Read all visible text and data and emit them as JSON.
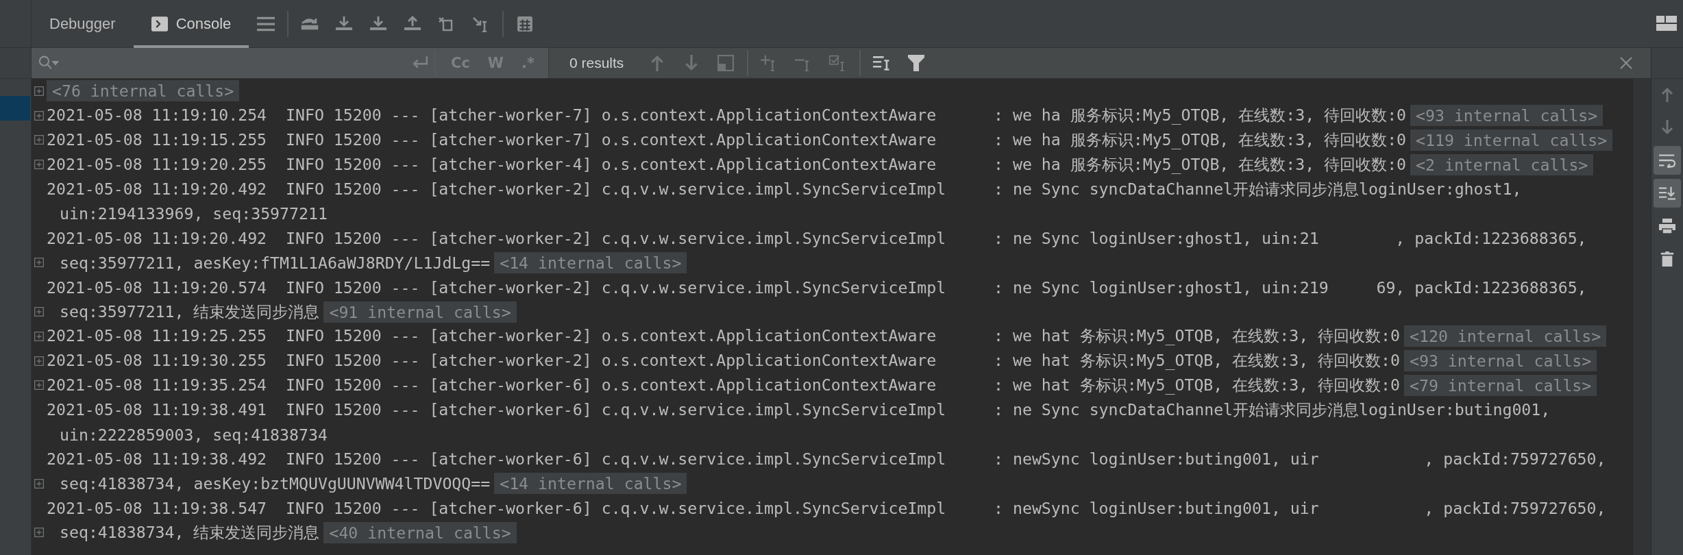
{
  "tabs": [
    {
      "label": "Debugger",
      "kind": "plain",
      "selected": false
    },
    {
      "label": "Console",
      "kind": "console",
      "selected": true
    }
  ],
  "search": {
    "options": [
      {
        "label": "Cc",
        "selected": false
      },
      {
        "label": "W",
        "selected": false
      },
      {
        "label": ".*",
        "selected": false
      }
    ],
    "results": "0 results"
  },
  "console": {
    "lines": [
      {
        "fold": true,
        "wrap": false,
        "calls": "<76 internal calls>"
      },
      {
        "fold": true,
        "wrap": false,
        "text": "2021-05-08 11:19:10.254  INFO 15200 --- [atcher-worker-7] o.s.context.ApplicationContextAware      : we ha 服务标识:My5_OTQB, 在线数:3, 待回收数:0",
        "calls": "<93 internal calls>"
      },
      {
        "fold": true,
        "wrap": false,
        "text": "2021-05-08 11:19:15.255  INFO 15200 --- [atcher-worker-7] o.s.context.ApplicationContextAware      : we ha 服务标识:My5_OTQB, 在线数:3, 待回收数:0",
        "calls": "<119 internal calls>"
      },
      {
        "fold": true,
        "wrap": false,
        "text": "2021-05-08 11:19:20.255  INFO 15200 --- [atcher-worker-4] o.s.context.ApplicationContextAware      : we ha 服务标识:My5_OTQB, 在线数:3, 待回收数:0",
        "calls": "<2 internal calls>"
      },
      {
        "fold": false,
        "wrap": false,
        "text": "2021-05-08 11:19:20.492  INFO 15200 --- [atcher-worker-2] c.q.v.w.service.impl.SyncServiceImpl     : ne Sync syncDataChannel开始请求同步消息loginUser:ghost1,"
      },
      {
        "fold": false,
        "wrap": true,
        "text": "uin:2194133969, seq:35977211"
      },
      {
        "fold": false,
        "wrap": false,
        "text": "2021-05-08 11:19:20.492  INFO 15200 --- [atcher-worker-2] c.q.v.w.service.impl.SyncServiceImpl     : ne Sync loginUser:ghost1, uin:21        , packId:1223688365,"
      },
      {
        "fold": true,
        "wrap": true,
        "text": "seq:35977211, aesKey:fTM1L1A6aWJ8RDY/L1JdLg==",
        "calls": "<14 internal calls>"
      },
      {
        "fold": false,
        "wrap": false,
        "text": "2021-05-08 11:19:20.574  INFO 15200 --- [atcher-worker-2] c.q.v.w.service.impl.SyncServiceImpl     : ne Sync loginUser:ghost1, uin:219     69, packId:1223688365,"
      },
      {
        "fold": true,
        "wrap": true,
        "text": "seq:35977211, 结束发送同步消息",
        "calls": "<91 internal calls>"
      },
      {
        "fold": true,
        "wrap": false,
        "text": "2021-05-08 11:19:25.255  INFO 15200 --- [atcher-worker-2] o.s.context.ApplicationContextAware      : we hat 务标识:My5_OTQB, 在线数:3, 待回收数:0",
        "calls": "<120 internal calls>"
      },
      {
        "fold": true,
        "wrap": false,
        "text": "2021-05-08 11:19:30.255  INFO 15200 --- [atcher-worker-2] o.s.context.ApplicationContextAware      : we hat 务标识:My5_OTQB, 在线数:3, 待回收数:0",
        "calls": "<93 internal calls>"
      },
      {
        "fold": true,
        "wrap": false,
        "text": "2021-05-08 11:19:35.254  INFO 15200 --- [atcher-worker-6] o.s.context.ApplicationContextAware      : we hat 务标识:My5_OTQB, 在线数:3, 待回收数:0",
        "calls": "<79 internal calls>"
      },
      {
        "fold": false,
        "wrap": false,
        "text": "2021-05-08 11:19:38.491  INFO 15200 --- [atcher-worker-6] c.q.v.w.service.impl.SyncServiceImpl     : ne Sync syncDataChannel开始请求同步消息loginUser:buting001,"
      },
      {
        "fold": false,
        "wrap": true,
        "text": "uin:2222859003, seq:41838734"
      },
      {
        "fold": false,
        "wrap": false,
        "text": "2021-05-08 11:19:38.492  INFO 15200 --- [atcher-worker-6] c.q.v.w.service.impl.SyncServiceImpl     : newSync loginUser:buting001, uir           , packId:759727650,"
      },
      {
        "fold": true,
        "wrap": true,
        "text": "seq:41838734, aesKey:bztMQUVgUUNVWW4lTDVOQQ==",
        "calls": "<14 internal calls>"
      },
      {
        "fold": false,
        "wrap": false,
        "text": "2021-05-08 11:19:38.547  INFO 15200 --- [atcher-worker-6] c.q.v.w.service.impl.SyncServiceImpl     : newSync loginUser:buting001, uir           , packId:759727650,"
      },
      {
        "fold": true,
        "wrap": true,
        "text": "seq:41838734, 结束发送同步消息",
        "calls": "<40 internal calls>"
      }
    ]
  },
  "side_tools": [
    {
      "kind": "up",
      "on": false
    },
    {
      "kind": "down",
      "on": false
    },
    {
      "kind": "wrap",
      "on": true
    },
    {
      "kind": "scroll-end",
      "on": true
    },
    {
      "kind": "print",
      "on": false
    },
    {
      "kind": "trash",
      "on": false
    }
  ]
}
